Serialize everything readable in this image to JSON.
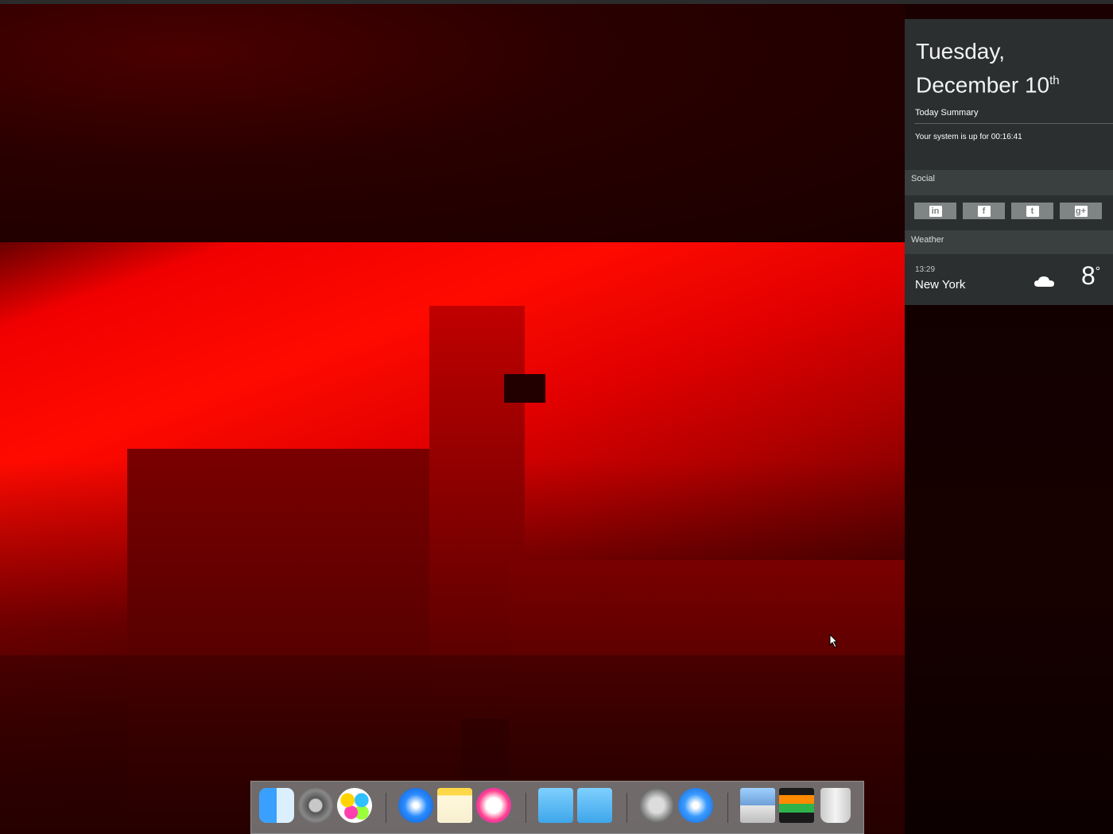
{
  "today": {
    "date_line1": "Tuesday,",
    "date_line2": "December 10",
    "date_suffix": "th",
    "summary_title": "Today Summary",
    "uptime_text": "Your system is up for 00:16:41",
    "social_title": "Social",
    "social_buttons": [
      {
        "label": "in",
        "icon": "linkedin-icon"
      },
      {
        "label": "f",
        "icon": "facebook-icon"
      },
      {
        "label": "t",
        "icon": "twitter-icon"
      },
      {
        "label": "g+",
        "icon": "google-plus-icon"
      }
    ],
    "weather_title": "Weather",
    "weather": {
      "time": "13:29",
      "city": "New York",
      "temperature": "8",
      "unit": "°",
      "condition_icon": "cloud-icon"
    }
  },
  "dock": {
    "items": [
      {
        "name": "finder",
        "icon": "finder-icon"
      },
      {
        "name": "system-preferences",
        "icon": "gear-icon"
      },
      {
        "name": "game-center",
        "icon": "game-center-icon"
      },
      {
        "name": "safari",
        "icon": "compass-icon"
      },
      {
        "name": "notes",
        "icon": "notes-icon"
      },
      {
        "name": "itunes",
        "icon": "music-note-icon"
      },
      {
        "name": "documents-folder",
        "icon": "folder-icon"
      },
      {
        "name": "applications-folder",
        "icon": "folder-icon"
      },
      {
        "name": "launchpad",
        "icon": "rocket-icon"
      },
      {
        "name": "app-store",
        "icon": "app-store-icon"
      },
      {
        "name": "preview",
        "icon": "preview-icon"
      },
      {
        "name": "activity-monitor",
        "icon": "monitor-icon"
      },
      {
        "name": "trash",
        "icon": "trash-icon"
      }
    ]
  },
  "colors": {
    "panel_bg": "#2b2f2f",
    "wallpaper_accent": "#ff0000"
  }
}
